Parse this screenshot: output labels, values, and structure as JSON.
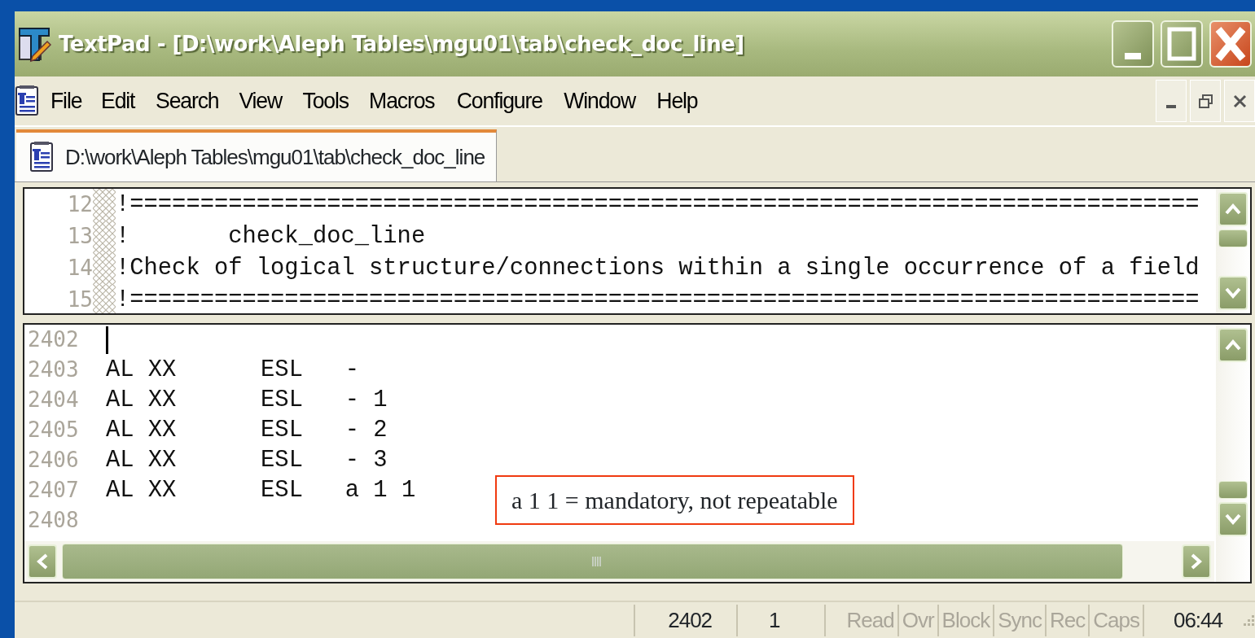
{
  "window": {
    "title": "TextPad - [D:\\work\\Aleph Tables\\mgu01\\tab\\check_doc_line]"
  },
  "menu": [
    "File",
    "Edit",
    "Search",
    "View",
    "Tools",
    "Macros",
    "Configure",
    "Window",
    "Help"
  ],
  "tabs": [
    {
      "label": "D:\\work\\Aleph Tables\\mgu01\\tab\\check_doc_line",
      "selected": true
    }
  ],
  "upper_pane": {
    "lines": [
      {
        "number": "12",
        "text": "!============================================================================"
      },
      {
        "number": "13",
        "text": "!       check_doc_line"
      },
      {
        "number": "14",
        "text": "!Check of logical structure/connections within a single occurrence of a field"
      },
      {
        "number": "15",
        "text": "!============================================================================"
      }
    ]
  },
  "lower_pane": {
    "lines": [
      {
        "number": "2402",
        "caret": true
      },
      {
        "number": "2403",
        "text": "AL XX      ESL   -",
        "caret": false
      },
      {
        "number": "2404",
        "text": "AL XX      ESL   - 1",
        "caret": false
      },
      {
        "number": "2405",
        "text": "AL XX      ESL   - 2",
        "caret": false
      },
      {
        "number": "2406",
        "text": "AL XX      ESL   - 3",
        "caret": false
      },
      {
        "number": "2407",
        "text": "AL XX      ESL   a 1 1",
        "caret": false
      },
      {
        "number": "2408",
        "caret": false
      }
    ]
  },
  "annotation": {
    "text": "a 1 1 = mandatory, not repeatable"
  },
  "status_bar": {
    "line": "2402",
    "column": "1",
    "indicators": [
      {
        "label": "Read",
        "on": false
      },
      {
        "label": "Ovr",
        "on": false
      },
      {
        "label": "Block",
        "on": false
      },
      {
        "label": "Sync",
        "on": false
      },
      {
        "label": "Rec",
        "on": false
      },
      {
        "label": "Caps",
        "on": false
      }
    ],
    "clock": "06:44"
  }
}
